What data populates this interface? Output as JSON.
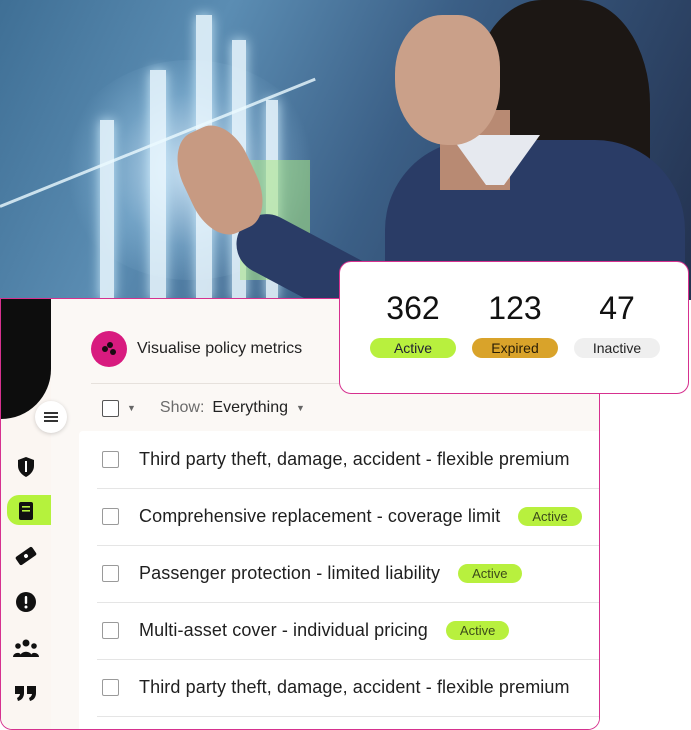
{
  "metrics": [
    {
      "value": "362",
      "label": "Active",
      "color": "#b8f03e"
    },
    {
      "value": "123",
      "label": "Expired",
      "color": "#d9a32a"
    },
    {
      "value": "47",
      "label": "Inactive",
      "color": "#efefef"
    }
  ],
  "header": {
    "title": "Visualise policy metrics",
    "brand_color": "#d81b7f"
  },
  "filter": {
    "show_label": "Show:",
    "show_value": "Everything"
  },
  "policies": [
    {
      "title": "Third party theft, damage, accident - flexible premium",
      "status": ""
    },
    {
      "title": "Comprehensive replacement - coverage limit",
      "status": "Active"
    },
    {
      "title": "Passenger protection - limited liability",
      "status": "Active"
    },
    {
      "title": "Multi-asset cover - individual pricing",
      "status": "Active"
    },
    {
      "title": "Third party theft, damage, accident - flexible premium",
      "status": ""
    }
  ],
  "nav": {
    "icons": [
      "shield-icon",
      "document-icon",
      "ticket-icon",
      "alert-icon",
      "people-icon",
      "quote-icon"
    ],
    "active_color": "#b5f23d"
  },
  "accent": "#d6318f"
}
